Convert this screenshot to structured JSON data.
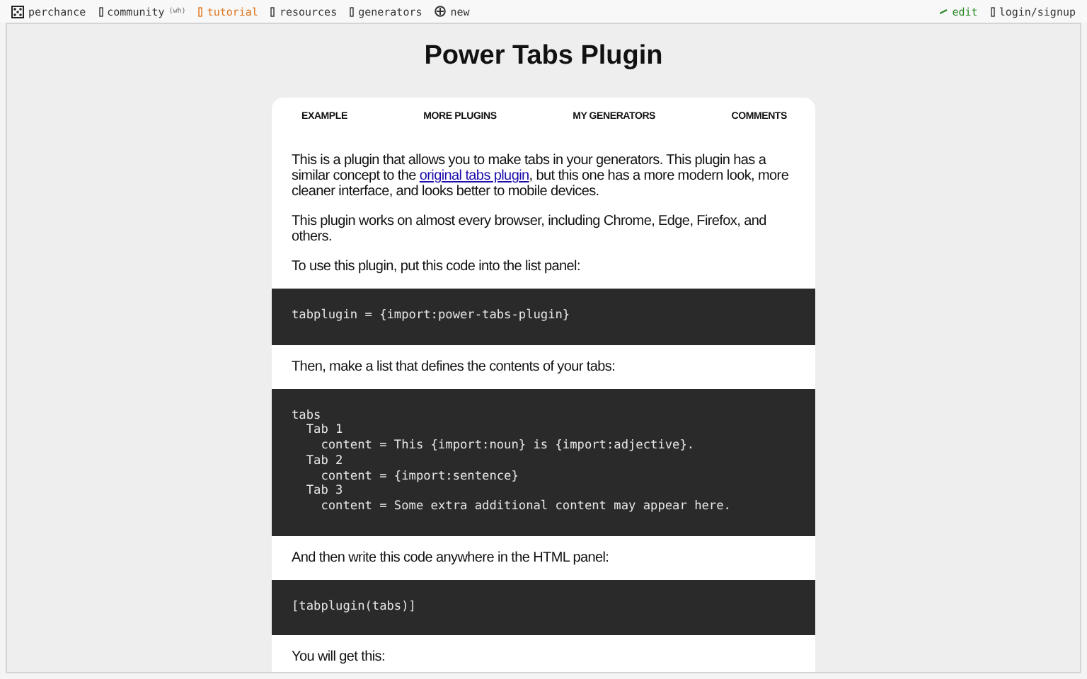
{
  "top_bar": {
    "left": [
      {
        "kind": "dice",
        "label": "perchance"
      },
      {
        "kind": "glyph",
        "label": "community",
        "badge": "(wh)"
      },
      {
        "kind": "glyph",
        "label": "tutorial",
        "highlight": true
      },
      {
        "kind": "glyph",
        "label": "resources"
      },
      {
        "kind": "glyph",
        "label": "generators"
      },
      {
        "kind": "plus",
        "label": "new"
      }
    ],
    "right": [
      {
        "kind": "pencil",
        "label": "edit"
      },
      {
        "kind": "glyph",
        "label": "login/signup"
      }
    ]
  },
  "page_title": "Power Tabs Plugin",
  "tabs": [
    "EXAMPLE",
    "MORE PLUGINS",
    "MY GENERATORS",
    "COMMENTS"
  ],
  "content": [
    {
      "kind": "para",
      "text": "This is a plugin that allows you to make tabs in your generators. This plugin has a similar concept to the ",
      "link": "original tabs plugin",
      "after": ", but this one has a more modern look, more cleaner interface, and looks better to mobile devices."
    },
    {
      "kind": "para",
      "text": "This plugin works on almost every browser, including Chrome, Edge, Firefox, and others."
    },
    {
      "kind": "para",
      "text": "To use this plugin, put this code into the list panel:"
    },
    {
      "kind": "code",
      "text": "tabplugin = {import:power-tabs-plugin}"
    },
    {
      "kind": "para",
      "text": "Then, make a list that defines the contents of your tabs:"
    },
    {
      "kind": "code",
      "text": "tabs\n  Tab 1\n    content = This {import:noun} is {import:adjective}.\n  Tab 2\n    content = {import:sentence}\n  Tab 3\n    content = Some extra additional content may appear here."
    },
    {
      "kind": "para",
      "text": "And then write this code anywhere in the HTML panel:"
    },
    {
      "kind": "code",
      "text": "[tabplugin(tabs)]"
    },
    {
      "kind": "para",
      "text": "You will get this:"
    }
  ]
}
